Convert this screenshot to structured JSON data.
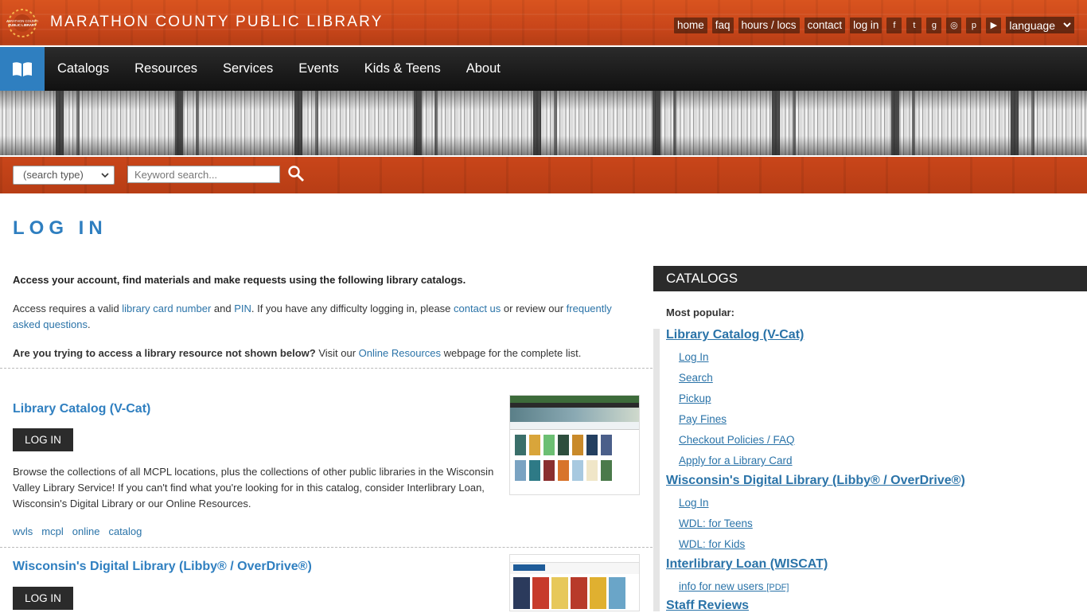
{
  "header": {
    "site_title": "MARATHON COUNTY PUBLIC LIBRARY",
    "logo_text": "MARATHON COUNTY PUBLIC LIBRARY",
    "utility_links": [
      "home",
      "faq",
      "hours / locs",
      "contact",
      "log in"
    ],
    "social_icons": [
      "facebook-icon",
      "twitter-icon",
      "goodreads-icon",
      "instagram-icon",
      "pinterest-icon",
      "youtube-icon"
    ],
    "social_glyphs": [
      "f",
      "t",
      "g",
      "◎",
      "p",
      "▶"
    ],
    "language_label": "language"
  },
  "nav": {
    "items": [
      "Catalogs",
      "Resources",
      "Services",
      "Events",
      "Kids & Teens",
      "About"
    ]
  },
  "search": {
    "type_label": "(search type)",
    "placeholder": "Keyword search..."
  },
  "page": {
    "title": "LOG IN",
    "intro": "Access your account, find materials and make requests using the following library catalogs.",
    "access_text_1": "Access requires a valid ",
    "access_link_card": "library card number",
    "access_text_2": " and ",
    "access_link_pin": "PIN",
    "access_text_3": ". If you have any difficulty logging in, please ",
    "access_link_contact": "contact us",
    "access_text_4": " or review our ",
    "access_link_faq": "frequently asked questions",
    "access_text_5": ".",
    "trying_bold": "Are you trying to access a library resource not shown below?",
    "trying_text_1": " Visit our ",
    "trying_link": "Online Resources",
    "trying_text_2": " webpage for the complete list."
  },
  "entries": [
    {
      "title": "Library Catalog (V-Cat)",
      "button": "LOG IN",
      "description": "Browse the collections of all MCPL locations, plus the collections of other public libraries in the Wisconsin Valley Library Service! If you can't find what you're looking for in this catalog, consider Interlibrary Loan, Wisconsin's Digital Library or our Online Resources.",
      "tags": [
        "wvls",
        "mcpl",
        "online",
        "catalog"
      ]
    },
    {
      "title": "Wisconsin's Digital Library (Libby® / OverDrive®)",
      "button": "LOG IN"
    }
  ],
  "sidebar": {
    "heading": "CATALOGS",
    "most_popular": "Most popular:",
    "groups": [
      {
        "title": "Library Catalog (V-Cat)",
        "links": [
          "Log In",
          "Search",
          "Pickup",
          "Pay Fines",
          "Checkout Policies / FAQ",
          "Apply for a Library Card"
        ]
      },
      {
        "title": "Wisconsin's Digital Library (Libby® / OverDrive®)",
        "links": [
          "Log In",
          "WDL: for Teens",
          "WDL: for Kids"
        ]
      },
      {
        "title": "Interlibrary Loan (WISCAT)",
        "links": [
          "info for new users"
        ],
        "pdf": "[PDF]"
      },
      {
        "title": "Staff Reviews",
        "links": []
      }
    ]
  },
  "colors": {
    "brand_orange": "#c9461a",
    "brand_blue": "#2f7fc0",
    "nav_black": "#1a1a1a"
  }
}
